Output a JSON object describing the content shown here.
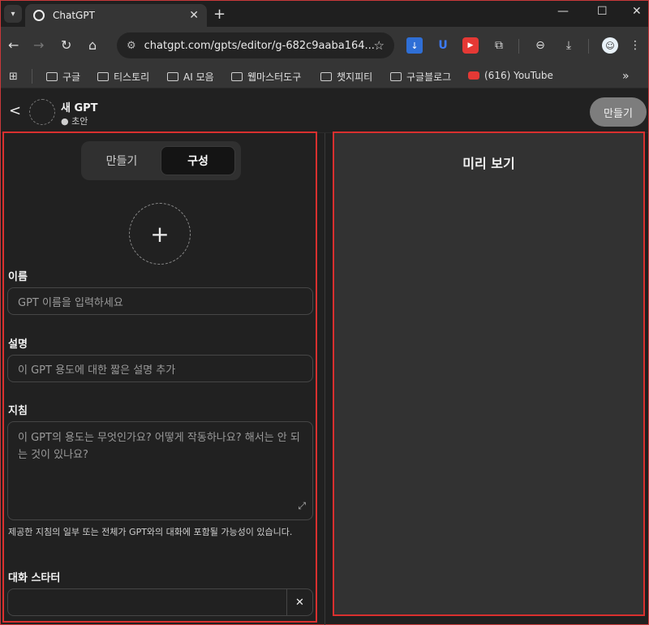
{
  "browser": {
    "tab_title": "ChatGPT",
    "url": "chatgpt.com/gpts/editor/g-682c9aaba164...",
    "bookmarks": [
      {
        "label": "구글",
        "icon": "folder-icon"
      },
      {
        "label": "티스토리",
        "icon": "folder-icon"
      },
      {
        "label": "AI 모음",
        "icon": "folder-icon"
      },
      {
        "label": "웹마스터도구",
        "icon": "folder-icon"
      },
      {
        "label": "챗지피티",
        "icon": "folder-icon"
      },
      {
        "label": "구글블로그",
        "icon": "folder-icon"
      },
      {
        "label": "(616) YouTube",
        "icon": "youtube-icon"
      }
    ]
  },
  "header": {
    "gpt_name": "새 GPT",
    "status": "● 초안",
    "create_button": "만들기"
  },
  "editor": {
    "tabs": [
      {
        "label": "만들기",
        "active": false
      },
      {
        "label": "구성",
        "active": true
      }
    ],
    "add_image": "+",
    "name_label": "이름",
    "name_placeholder": "GPT 이름을 입력하세요",
    "description_label": "설명",
    "description_placeholder": "이 GPT 용도에 대한 짧은 설명 추가",
    "instructions_label": "지침",
    "instructions_placeholder": "이 GPT의 용도는 무엇인가요? 어떻게 작동하나요? 해서는 안 되는 것이 있나요?",
    "instructions_note": "제공한 지침의 일부 또는 전체가 GPT와의 대화에 포함될 가능성이 있습니다.",
    "starter_label": "대화 스타터",
    "starter_value": "",
    "starter_clear": "✕"
  },
  "preview": {
    "title": "미리 보기"
  },
  "colors": {
    "highlight": "#d9302f",
    "background": "#212121",
    "preview_background": "#323232"
  }
}
